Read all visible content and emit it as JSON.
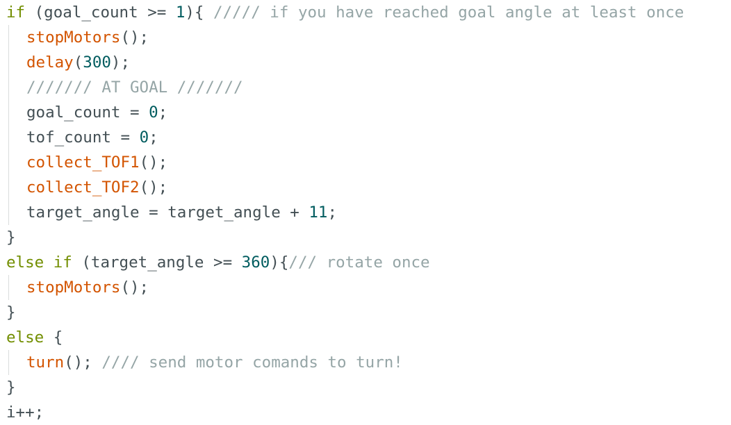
{
  "code": {
    "l1": {
      "kw_if": "if",
      "cond_open": " (goal_count >= ",
      "num": "1",
      "cond_close": "){ ",
      "comment": "///// if you have reached goal angle at least once"
    },
    "l2": {
      "fn": "stopMotors",
      "rest": "();"
    },
    "l3": {
      "fn": "delay",
      "open": "(",
      "num": "300",
      "close": ");"
    },
    "l4": {
      "comment": "/////// AT GOAL ///////"
    },
    "l5": {
      "text": "goal_count = ",
      "num": "0",
      "end": ";"
    },
    "l6": {
      "text": "tof_count = ",
      "num": "0",
      "end": ";"
    },
    "l7": {
      "fn": "collect_TOF1",
      "rest": "();"
    },
    "l8": {
      "fn": "collect_TOF2",
      "rest": "();"
    },
    "l9": {
      "text": "target_angle = target_angle + ",
      "num": "11",
      "end": ";"
    },
    "l10": {
      "brace": "}"
    },
    "l11": {
      "kw_else": "else",
      "sp": " ",
      "kw_if": "if",
      "cond_open": " (target_angle >= ",
      "num": "360",
      "cond_close": "){",
      "comment": "/// rotate once"
    },
    "l12": {
      "fn": "stopMotors",
      "rest": "();"
    },
    "l13": {
      "brace": "}"
    },
    "l14": {
      "kw_else": "else",
      "rest": " {"
    },
    "l15": {
      "fn": "turn",
      "rest": "(); ",
      "comment": "//// send motor comands to turn!"
    },
    "l16": {
      "brace": "}"
    },
    "l17": {
      "text": "i++;"
    }
  },
  "colors": {
    "keyword": "#728e00",
    "function": "#d35400",
    "number": "#005c5f",
    "comment": "#95a5a6",
    "text": "#434f54"
  }
}
